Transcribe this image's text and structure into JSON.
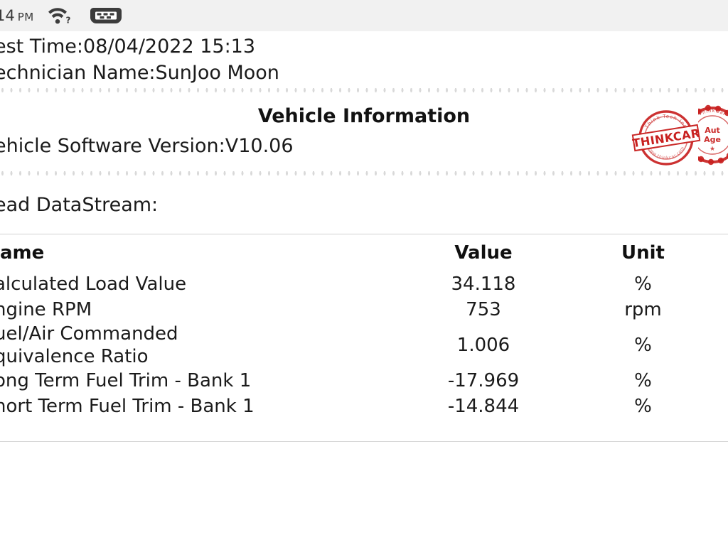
{
  "status_bar": {
    "time": "14",
    "ampm": "PM",
    "wifi_icon": "wifi-unknown-icon",
    "usb_icon": "usb-connector-icon"
  },
  "report": {
    "test_time_line": "est Time:08/04/2022 15:13",
    "technician_line": "echnician Name:SunJoo Moon"
  },
  "vehicle_information": {
    "title": "Vehicle Information",
    "software_version_line": "ehicle Software Version:V10.06",
    "stamps": [
      {
        "name": "thinkcar-stamp",
        "banner_text": "THINKCAR",
        "ring_top_text": "Think Tech Inc",
        "ring_bottom_text": "www.thinkcar.com",
        "color": "#c8201f"
      },
      {
        "name": "authorized-agent-stamp",
        "ring_top_text": "ThinkCar",
        "line1": "Aut",
        "line2": "Age",
        "color": "#c8201f"
      }
    ]
  },
  "datastream": {
    "label": "ead DataStream:",
    "columns": [
      "ame",
      "Value",
      "Unit"
    ],
    "rows": [
      {
        "name": "alculated Load Value",
        "value": "34.118",
        "unit": "%"
      },
      {
        "name": "ngine RPM",
        "value": "753",
        "unit": "rpm"
      },
      {
        "name": "uel/Air Commanded\nquivalence Ratio",
        "value": "1.006",
        "unit": "%"
      },
      {
        "name": "ong Term Fuel Trim - Bank 1",
        "value": "-17.969",
        "unit": "%"
      },
      {
        "name": "hort Term Fuel Trim - Bank 1",
        "value": "-14.844",
        "unit": "%"
      }
    ]
  }
}
